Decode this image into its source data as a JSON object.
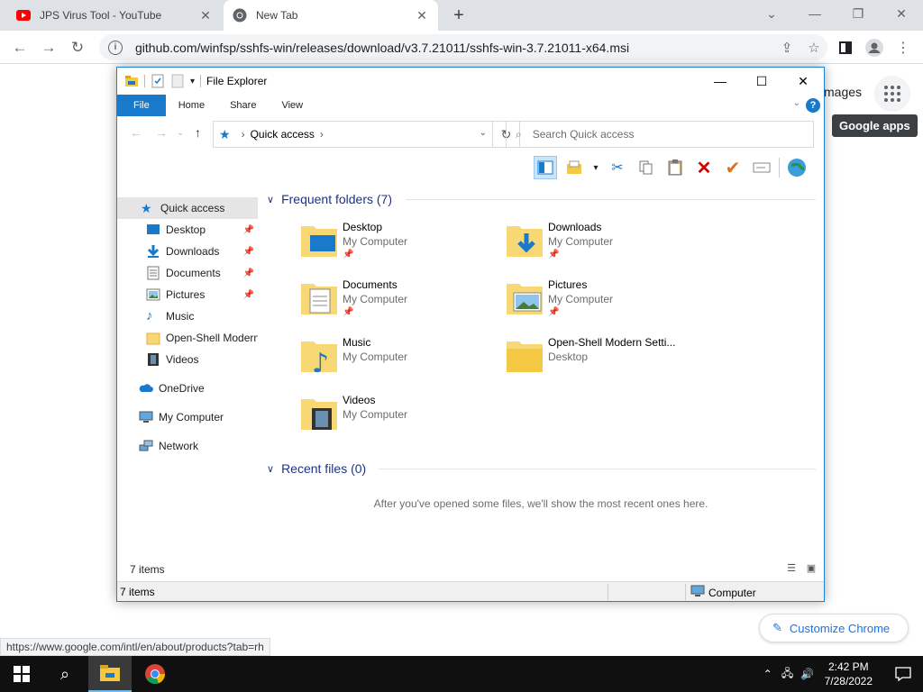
{
  "browser": {
    "tabs": [
      {
        "title": "JPS Virus Tool - YouTube",
        "favicon": "youtube-icon"
      },
      {
        "title": "New Tab",
        "favicon": "chrome-icon"
      }
    ],
    "url": "github.com/winfsp/sshfs-win/releases/download/v3.7.21011/sshfs-win-3.7.21011-x64.msi",
    "page": {
      "images_link": "mages",
      "tooltip": "Google apps",
      "customize_label": "Customize Chrome",
      "status_url": "https://www.google.com/intl/en/about/products?tab=rh"
    }
  },
  "explorer": {
    "title": "File Explorer",
    "ribbon_tabs": [
      "File",
      "Home",
      "Share",
      "View"
    ],
    "address": {
      "location": "Quick access"
    },
    "search_placeholder": "Search Quick access",
    "nav": {
      "quick_access": "Quick access",
      "items": [
        {
          "label": "Desktop",
          "pinned": true
        },
        {
          "label": "Downloads",
          "pinned": true
        },
        {
          "label": "Documents",
          "pinned": true
        },
        {
          "label": "Pictures",
          "pinned": true
        },
        {
          "label": "Music",
          "pinned": false
        },
        {
          "label": "Open-Shell Modern",
          "pinned": false
        },
        {
          "label": "Videos",
          "pinned": false
        }
      ],
      "onedrive": "OneDrive",
      "my_computer": "My Computer",
      "network": "Network"
    },
    "frequent": {
      "header": "Frequent folders (7)",
      "folders": [
        {
          "name": "Desktop",
          "location": "My Computer",
          "pinned": true
        },
        {
          "name": "Downloads",
          "location": "My Computer",
          "pinned": true
        },
        {
          "name": "Documents",
          "location": "My Computer",
          "pinned": true
        },
        {
          "name": "Pictures",
          "location": "My Computer",
          "pinned": true
        },
        {
          "name": "Music",
          "location": "My Computer",
          "pinned": false
        },
        {
          "name": "Open-Shell Modern Setti...",
          "location": "Desktop",
          "pinned": false
        },
        {
          "name": "Videos",
          "location": "My Computer",
          "pinned": false
        }
      ]
    },
    "recent": {
      "header": "Recent files (0)",
      "empty_message": "After you've opened some files, we'll show the most recent ones here."
    },
    "status": {
      "items_count": "7 items",
      "bottom_left": "7 items",
      "bottom_right": "Computer"
    }
  },
  "taskbar": {
    "time": "2:42 PM",
    "date": "7/28/2022"
  },
  "colors": {
    "accent": "#1979ca",
    "chrome_blue": "#1a73e8",
    "taskbar": "#101010"
  }
}
